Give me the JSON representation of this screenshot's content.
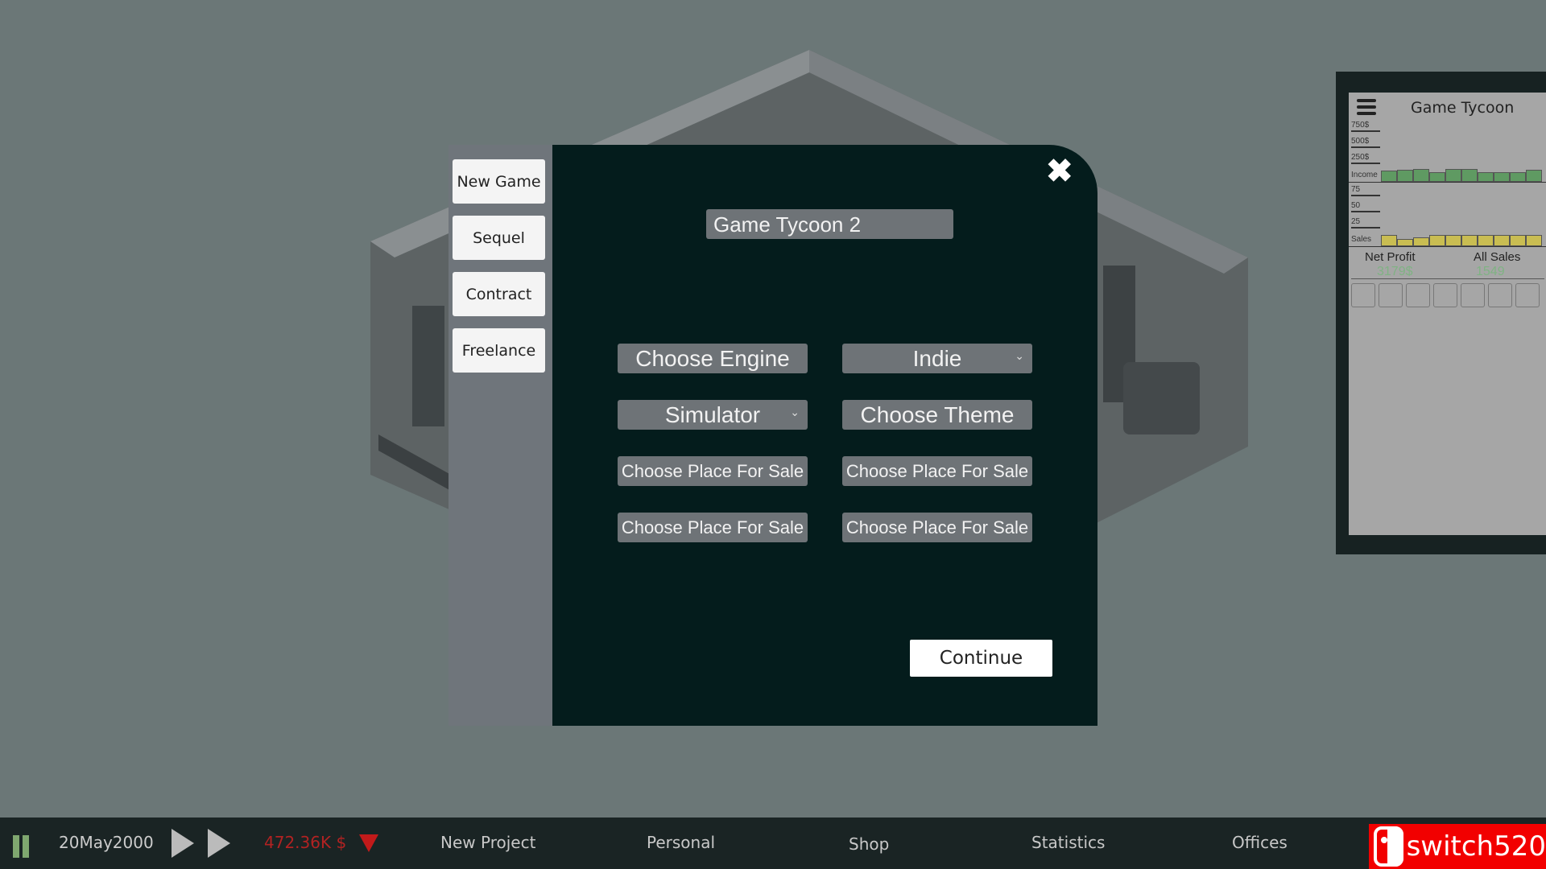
{
  "sidebar": {
    "items": [
      {
        "label": "New Game"
      },
      {
        "label": "Sequel"
      },
      {
        "label": "Contract"
      },
      {
        "label": "Freelance"
      }
    ]
  },
  "modal": {
    "title_value": "Game Tycoon 2",
    "engine_label": "Choose Engine",
    "size_value": "Indie",
    "genre_value": "Simulator",
    "theme_label": "Choose Theme",
    "places": [
      "Choose Place For Sale",
      "Choose Place For Sale",
      "Choose Place For Sale",
      "Choose Place For Sale"
    ],
    "continue_label": "Continue",
    "close_icon": "close-icon"
  },
  "stats_panel": {
    "title": "Game Tycoon",
    "income_ticks": [
      "750$",
      "500$",
      "250$",
      "Income"
    ],
    "sales_ticks": [
      "75",
      "50",
      "25",
      "Sales"
    ],
    "net_profit_label": "Net Profit",
    "net_profit_value": "3179$",
    "all_sales_label": "All Sales",
    "all_sales_value": "1549",
    "colors": {
      "income": "#5f9a62",
      "sales": "#c9bd52",
      "value": "#7fb383"
    },
    "icons": [
      "community-icon",
      "email-icon",
      "social-icon",
      "web-page-icon",
      "tv-icon",
      "globe-icon",
      "media-icon"
    ]
  },
  "chart_data": [
    {
      "type": "bar",
      "series": [
        {
          "name": "Income",
          "values": [
            171,
            193,
            204,
            150,
            204,
            204,
            150,
            150,
            150,
            193
          ]
        }
      ],
      "ylim": [
        0,
        750
      ],
      "yticks": [
        "250$",
        "500$",
        "750$"
      ]
    },
    {
      "type": "bar",
      "series": [
        {
          "name": "Sales",
          "values": [
            18,
            11,
            14,
            18,
            18,
            18,
            18,
            18,
            18,
            18
          ]
        }
      ],
      "ylim": [
        0,
        75
      ],
      "yticks": [
        "25",
        "50",
        "75"
      ]
    }
  ],
  "bottom_bar": {
    "date": "20May2000",
    "money": "472.36K $",
    "money_color": "#b22222",
    "items": [
      "New Project",
      "Personal",
      "Shop",
      "Statistics",
      "Offices"
    ],
    "watermark": "switch520"
  }
}
